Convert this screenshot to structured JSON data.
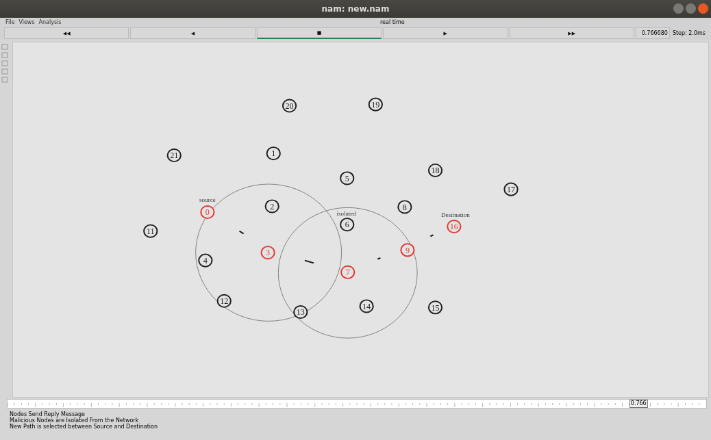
{
  "window": {
    "title": "nam: new.nam"
  },
  "menu": [
    "File",
    "Views",
    "Analysis"
  ],
  "time_label": "real time",
  "controls": [
    {
      "symbol": "◀◀",
      "selected": false
    },
    {
      "symbol": "◀",
      "selected": false
    },
    {
      "symbol": "■",
      "selected": true
    },
    {
      "symbol": "▶",
      "selected": false
    },
    {
      "symbol": "▶▶",
      "selected": false
    }
  ],
  "time_value": "0.766680",
  "step": "Step: 2.0ms",
  "labels": [
    "source",
    "isolated",
    "Destination"
  ],
  "nodes": [
    {
      "label": "20",
      "color": "#222222"
    },
    {
      "label": "19",
      "color": "#222222"
    },
    {
      "label": "21",
      "color": "#222222"
    },
    {
      "label": "1",
      "color": "#222222"
    },
    {
      "label": "5",
      "color": "#222222"
    },
    {
      "label": "18",
      "color": "#222222"
    },
    {
      "label": "17",
      "color": "#222222"
    },
    {
      "label": "2",
      "color": "#222222"
    },
    {
      "label": "0",
      "color": "#e53935"
    },
    {
      "label": "8",
      "color": "#222222"
    },
    {
      "label": "6",
      "color": "#222222"
    },
    {
      "label": "16",
      "color": "#e53935"
    },
    {
      "label": "11",
      "color": "#222222"
    },
    {
      "label": "4",
      "color": "#222222"
    },
    {
      "label": "3",
      "color": "#e53935"
    },
    {
      "label": "9",
      "color": "#e53935"
    },
    {
      "label": "7",
      "color": "#e53935"
    },
    {
      "label": "12",
      "color": "#222222"
    },
    {
      "label": "13",
      "color": "#222222"
    },
    {
      "label": "14",
      "color": "#222222"
    },
    {
      "label": "15",
      "color": "#222222"
    }
  ],
  "timeline": {
    "marker": "0.766",
    "level": 0.89
  },
  "messages": [
    "Nodes Send Reply Message",
    "Malicious Nodes are Isolated From the Network",
    "New Path is selected between Source and Destination"
  ]
}
